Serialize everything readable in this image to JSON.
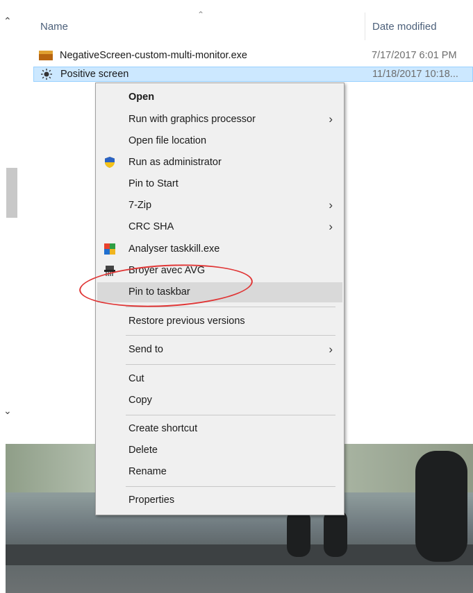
{
  "explorer": {
    "columns": {
      "name": "Name",
      "date_modified": "Date modified"
    },
    "files": [
      {
        "name": "NegativeScreen-custom-multi-monitor.exe",
        "date": "7/17/2017 6:01 PM",
        "icon": "exe-icon"
      },
      {
        "name": "Positive screen",
        "date": "11/18/2017 10:18...",
        "icon": "sun-icon",
        "selected": true
      }
    ]
  },
  "context_menu": {
    "items": {
      "open": "Open",
      "run_gpu": "Run with graphics processor",
      "open_location": "Open file location",
      "run_admin": "Run as administrator",
      "pin_start": "Pin to Start",
      "zip": "7-Zip",
      "crc": "CRC SHA",
      "analyser": "Analyser taskkill.exe",
      "broyer": "Broyer avec AVG",
      "pin_taskbar": "Pin to taskbar",
      "restore": "Restore previous versions",
      "send_to": "Send to",
      "cut": "Cut",
      "copy": "Copy",
      "create_shortcut": "Create shortcut",
      "delete": "Delete",
      "rename": "Rename",
      "properties": "Properties"
    },
    "highlighted": "pin_taskbar"
  },
  "colors": {
    "selection": "#cce8ff",
    "annotation": "#e03535",
    "menu_bg": "#f0f0f0"
  }
}
